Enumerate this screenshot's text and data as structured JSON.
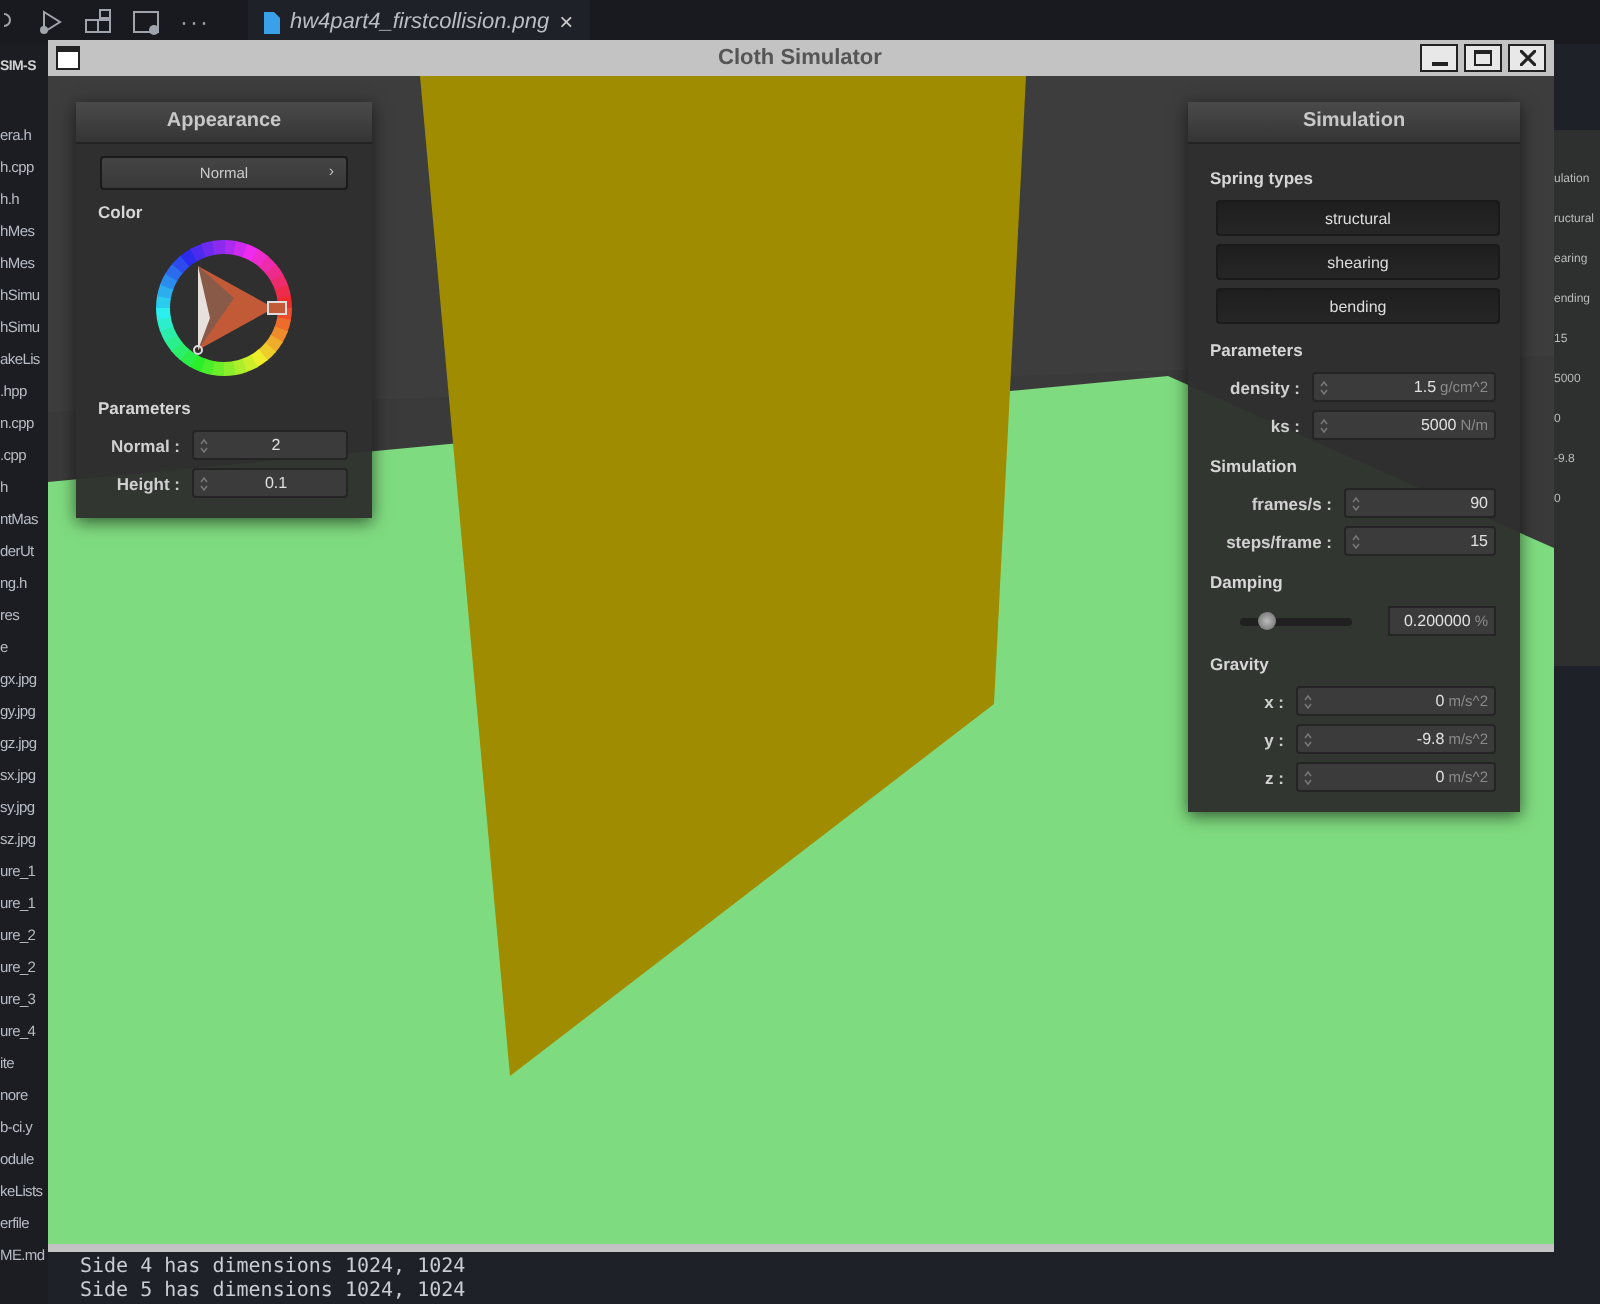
{
  "editor": {
    "explorer_header": "SIM-S",
    "files": [
      "era.h",
      "h.cpp",
      "h.h",
      "hMes",
      "hMes",
      "hSimu",
      "hSimu",
      "akeLis",
      ".hpp",
      "n.cpp",
      ".cpp",
      "h",
      "ntMas",
      "derUt",
      "ng.h",
      "res",
      "e",
      "gx.jpg",
      "gy.jpg",
      "gz.jpg",
      "sx.jpg",
      "sy.jpg",
      "sz.jpg",
      "ure_1",
      "ure_1",
      "ure_2",
      "ure_2",
      "ure_3",
      "ure_4",
      "ite",
      "nore",
      "b-ci.y",
      "odule",
      "keLists",
      "erfile",
      "ME.md"
    ],
    "tab": {
      "label": "hw4part4_firstcollision.png",
      "close": "×"
    },
    "toolbar_more": "···",
    "terminal_lines": [
      "Side 4 has dimensions 1024, 1024",
      "Side 5 has dimensions 1024, 1024"
    ],
    "background_window_fragments": [
      "ulation",
      "ructural",
      "earing",
      "ending",
      "15",
      "5000",
      "0",
      "-9.8",
      "0"
    ]
  },
  "window": {
    "title": "Cloth Simulator",
    "appearance": {
      "title": "Appearance",
      "shader": "Normal",
      "shader_arrow": "›",
      "color_label": "Color",
      "parameters_label": "Parameters",
      "fields": [
        {
          "label": "Normal :",
          "value": "2"
        },
        {
          "label": "Height :",
          "value": "0.1"
        }
      ]
    },
    "simulation": {
      "title": "Simulation",
      "spring_label": "Spring types",
      "springs": [
        {
          "label": "structural",
          "on": true
        },
        {
          "label": "shearing",
          "on": true
        },
        {
          "label": "bending",
          "on": true
        }
      ],
      "parameters_label": "Parameters",
      "parameters": [
        {
          "label": "density :",
          "value": "1.5",
          "unit": "g/cm^2"
        },
        {
          "label": "ks :",
          "value": "5000",
          "unit": "N/m"
        }
      ],
      "simulation_label": "Simulation",
      "simulation": [
        {
          "label": "frames/s :",
          "value": "90"
        },
        {
          "label": "steps/frame :",
          "value": "15"
        }
      ],
      "damping_label": "Damping",
      "damping": {
        "level": 0.24,
        "value": "0.200000",
        "unit": "%"
      },
      "gravity_label": "Gravity",
      "gravity": [
        {
          "label": "x :",
          "value": "0",
          "unit": "m/s^2"
        },
        {
          "label": "y :",
          "value": "-9.8",
          "unit": "m/s^2"
        },
        {
          "label": "z :",
          "value": "0",
          "unit": "m/s^2"
        }
      ]
    }
  }
}
